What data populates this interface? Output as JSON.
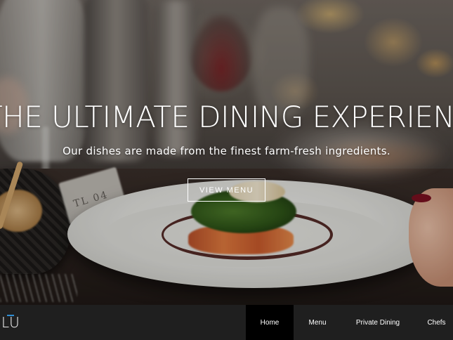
{
  "hero": {
    "title": "THE ULTIMATE DINING EXPERIENCE",
    "subtitle": "Our dishes are made from the finest farm-fresh ingredients.",
    "cta_label": "VIEW MENU",
    "card_text": "TL 04"
  },
  "navbar": {
    "logo": "LU",
    "accent_color": "#2f8fd6",
    "items": [
      {
        "label": "Home",
        "active": true
      },
      {
        "label": "Menu",
        "active": false
      },
      {
        "label": "Private Dining",
        "active": false
      },
      {
        "label": "Chefs",
        "active": false
      }
    ]
  }
}
